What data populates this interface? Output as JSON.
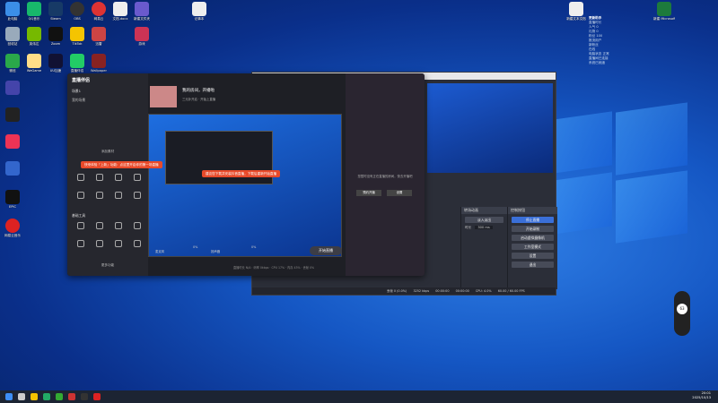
{
  "desktop": {
    "icons": [
      {
        "label": "此电脑"
      },
      {
        "label": "QQ音乐"
      },
      {
        "label": "Steam"
      },
      {
        "label": "OBS"
      },
      {
        "label": "网易云"
      },
      {
        "label": "文档.docx"
      },
      {
        "label": "新建文件夹"
      },
      {
        "label": "回收站"
      },
      {
        "label": "英伟达"
      },
      {
        "label": "Zoom"
      },
      {
        "label": "TikTok"
      },
      {
        "label": "迅雷"
      },
      {
        "label": "微信"
      },
      {
        "label": "WeGame"
      },
      {
        "label": "游戏"
      },
      {
        "label": "UU加速"
      },
      {
        "label": "直播伴侣"
      },
      {
        "label": "Wallpaper"
      },
      {
        "label": "EPIC"
      },
      {
        "label": "Epic Games Launcher"
      },
      {
        "label": "网易云音乐"
      }
    ],
    "top_file_label": "记事本",
    "right_files": [
      {
        "label": "新建文本文档"
      },
      {
        "label": "新建 Microsoft Excel 工作表"
      }
    ]
  },
  "live_companion": {
    "app_title": "直播伴侣",
    "scene_tab": "场景1",
    "my_scene_label": "我的场景",
    "add_source": "添加素材",
    "stream_title": "我的房间，开播啦",
    "stream_hint": "三元补开启 · 开始上直播",
    "banner_main": "快来体验「上新」功能：点这里开启你的第一场直播",
    "banner_warn": "建议您下载并安装抖音直播，下载后重新开始直播",
    "tools_header": "基础工具",
    "tools_more": "更多功能",
    "go_live_button": "开始直播",
    "mic_label": "麦克风",
    "speaker_label": "扬声器",
    "vol_mic": "0%",
    "vol_speaker": "0%",
    "bottom_stats": "直播时长 N/A · 码率 0kbps · CPU 17% · 内存 43% · 丢帧 0%",
    "rightpanel_hint": "您暂时没有正在直播的房间，快去开播吧",
    "btn_schedule": "预约开播",
    "btn_settings": "设置"
  },
  "obs": {
    "dock_controls_title": "控制按钮",
    "dock_transitions_title": "转场动画",
    "transition_value": "淡入淡出",
    "duration_label": "时长",
    "duration_value": "300 ms",
    "btn_stop_stream": "停止直播",
    "btn_start_record": "开始录制",
    "btn_virtual_cam": "启动虚拟摄像机",
    "btn_studio_mode": "工作室模式",
    "btn_settings": "设置",
    "btn_exit": "退出",
    "status_drop": "丢帧 0 (0.0%)",
    "status_bitrate": "3252 kbps",
    "status_rec": "00:00:00",
    "status_live": "00:00:00",
    "status_cpu": "CPU: 4.0%",
    "status_fps": "60.00 / 60.00 FPS"
  },
  "side_panel": {
    "title": "更新助手",
    "lines": [
      "直播时长",
      "人气 0",
      "礼物 0",
      "粉丝 100",
      "推流用户",
      "新粉丝",
      "在线",
      "电脑状态 正常",
      "直播间已连接",
      "系统已就绪"
    ]
  },
  "taskbar": {
    "time": "20:01",
    "date": "2025/10/13"
  },
  "gauge_value": "63"
}
